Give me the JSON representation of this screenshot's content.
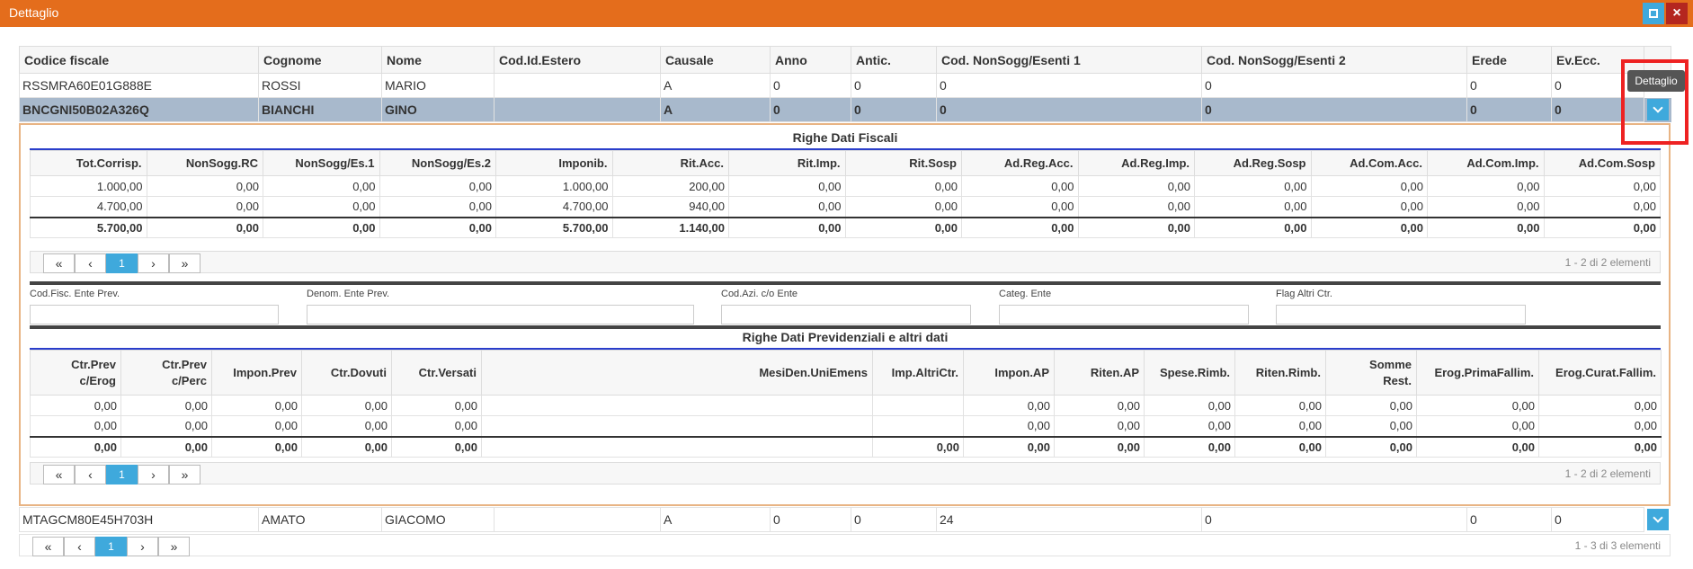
{
  "window": {
    "title": "Dettaglio"
  },
  "tooltip": "Dettaglio",
  "main": {
    "headers": [
      "Codice fiscale",
      "Cognome",
      "Nome",
      "Cod.Id.Estero",
      "Causale",
      "Anno",
      "Antic.",
      "Cod. NonSogg/Esenti 1",
      "Cod. NonSogg/Esenti 2",
      "Erede",
      "Ev.Ecc."
    ],
    "rows": [
      [
        "RSSMRA60E01G888E",
        "ROSSI",
        "MARIO",
        "",
        "A",
        "0",
        "0",
        "0",
        "0",
        "0",
        "0"
      ],
      [
        "BNCGNI50B02A326Q",
        "BIANCHI",
        "GINO",
        "",
        "A",
        "0",
        "0",
        "0",
        "0",
        "0",
        "0"
      ],
      [
        "MTAGCM80E45H703H",
        "AMATO",
        "GIACOMO",
        "",
        "A",
        "0",
        "0",
        "24",
        "0",
        "0",
        "0"
      ]
    ],
    "pager": {
      "first": "«",
      "prev": "‹",
      "page": "1",
      "next": "›",
      "last": "»",
      "info": "1 - 3 di 3 elementi"
    }
  },
  "fiscali": {
    "title": "Righe Dati Fiscali",
    "headers": [
      "Tot.Corrisp.",
      "NonSogg.RC",
      "NonSogg/Es.1",
      "NonSogg/Es.2",
      "Imponib.",
      "Rit.Acc.",
      "Rit.Imp.",
      "Rit.Sosp",
      "Ad.Reg.Acc.",
      "Ad.Reg.Imp.",
      "Ad.Reg.Sosp",
      "Ad.Com.Acc.",
      "Ad.Com.Imp.",
      "Ad.Com.Sosp"
    ],
    "rows": [
      [
        "1.000,00",
        "0,00",
        "0,00",
        "0,00",
        "1.000,00",
        "200,00",
        "0,00",
        "0,00",
        "0,00",
        "0,00",
        "0,00",
        "0,00",
        "0,00",
        "0,00"
      ],
      [
        "4.700,00",
        "0,00",
        "0,00",
        "0,00",
        "4.700,00",
        "940,00",
        "0,00",
        "0,00",
        "0,00",
        "0,00",
        "0,00",
        "0,00",
        "0,00",
        "0,00"
      ]
    ],
    "totals": [
      "5.700,00",
      "0,00",
      "0,00",
      "0,00",
      "5.700,00",
      "1.140,00",
      "0,00",
      "0,00",
      "0,00",
      "0,00",
      "0,00",
      "0,00",
      "0,00",
      "0,00"
    ],
    "pager": {
      "first": "«",
      "prev": "‹",
      "page": "1",
      "next": "›",
      "last": "»",
      "info": "1 - 2 di 2 elementi"
    }
  },
  "ente": {
    "labels": [
      "Cod.Fisc. Ente Prev.",
      "Denom. Ente Prev.",
      "Cod.Azi. c/o Ente",
      "Categ. Ente",
      "Flag Altri Ctr."
    ],
    "values": [
      "",
      "",
      "",
      "",
      ""
    ]
  },
  "previdenziali": {
    "title": "Righe Dati Previdenziali e altri dati",
    "headers": [
      "Ctr.Prev\nc/Erog",
      "Ctr.Prev\nc/Perc",
      "Impon.Prev",
      "Ctr.Dovuti",
      "Ctr.Versati",
      "MesiDen.UniEmens",
      "Imp.AltriCtr.",
      "Impon.AP",
      "Riten.AP",
      "Spese.Rimb.",
      "Riten.Rimb.",
      "Somme\nRest.",
      "Erog.PrimaFallim.",
      "Erog.Curat.Fallim."
    ],
    "rows": [
      [
        "0,00",
        "0,00",
        "0,00",
        "0,00",
        "0,00",
        "",
        "",
        "0,00",
        "0,00",
        "0,00",
        "0,00",
        "0,00",
        "0,00",
        "0,00"
      ],
      [
        "0,00",
        "0,00",
        "0,00",
        "0,00",
        "0,00",
        "",
        "",
        "0,00",
        "0,00",
        "0,00",
        "0,00",
        "0,00",
        "0,00",
        "0,00"
      ]
    ],
    "totals": [
      "0,00",
      "0,00",
      "0,00",
      "0,00",
      "0,00",
      "",
      "0,00",
      "0,00",
      "0,00",
      "0,00",
      "0,00",
      "0,00",
      "0,00",
      "0,00"
    ],
    "pager": {
      "first": "«",
      "prev": "‹",
      "page": "1",
      "next": "›",
      "last": "»",
      "info": "1 - 2 di 2 elementi"
    }
  },
  "colors": {
    "titlebar": "#e46d1c",
    "accent": "#3fa9dc",
    "selected_row": "#a8b9cc",
    "highlight": "#e22222"
  }
}
